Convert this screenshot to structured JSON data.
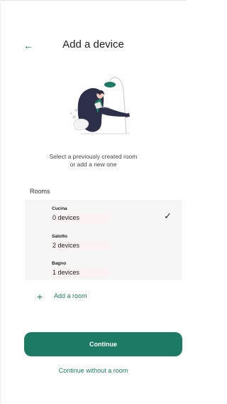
{
  "header": {
    "title": "Add a device",
    "back_icon": "back-arrow-icon"
  },
  "intro": {
    "line1": "Select a previously created room",
    "line2": "or add a new one"
  },
  "rooms": {
    "label": "Rooms",
    "items": [
      {
        "name": "Cucina",
        "count": "0",
        "unit": "devices",
        "selected": true
      },
      {
        "name": "Salotto",
        "count": "2",
        "unit": "devices",
        "selected": false
      },
      {
        "name": "Bagno",
        "count": "1",
        "unit": "devices",
        "selected": false
      }
    ]
  },
  "add_room": {
    "label": "Add a room",
    "icon": "plus-icon"
  },
  "buttons": {
    "continue": "Continue",
    "continue_without": "Continue without a room"
  },
  "colors": {
    "accent": "#1d7b64",
    "accent_text": "#1e7c63",
    "rooms_bg": "#f6f6f6"
  }
}
